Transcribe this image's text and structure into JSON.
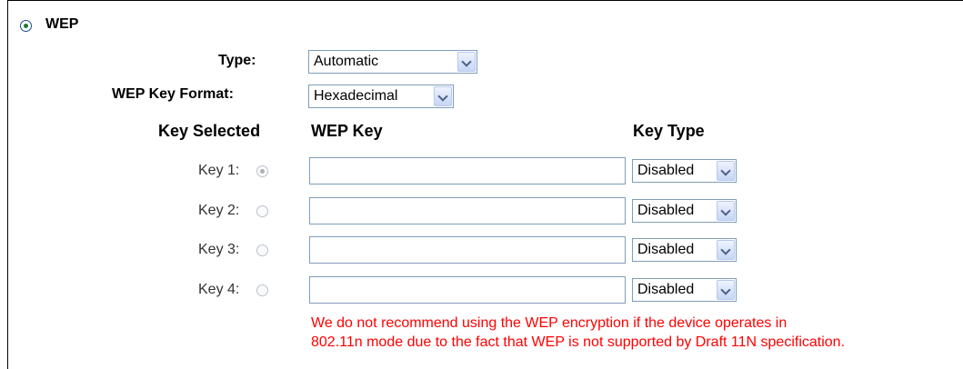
{
  "wep": {
    "label": "WEP",
    "selected": true
  },
  "type": {
    "label": "Type:",
    "value": "Automatic"
  },
  "key_format": {
    "label": "WEP Key Format:",
    "value": "Hexadecimal"
  },
  "columns": {
    "key_selected": "Key Selected",
    "wep_key": "WEP Key",
    "key_type": "Key Type"
  },
  "keys": [
    {
      "label": "Key 1:",
      "selected": true,
      "value": "",
      "type": "Disabled"
    },
    {
      "label": "Key 2:",
      "selected": false,
      "value": "",
      "type": "Disabled"
    },
    {
      "label": "Key 3:",
      "selected": false,
      "value": "",
      "type": "Disabled"
    },
    {
      "label": "Key 4:",
      "selected": false,
      "value": "",
      "type": "Disabled"
    }
  ],
  "warning": {
    "line1": "We do not recommend using the WEP encryption if the device operates in",
    "line2": "802.11n mode due to the fact that WEP is not supported by Draft 11N specification."
  },
  "colors": {
    "warning": "#ff0000",
    "border": "#7f9db9"
  }
}
